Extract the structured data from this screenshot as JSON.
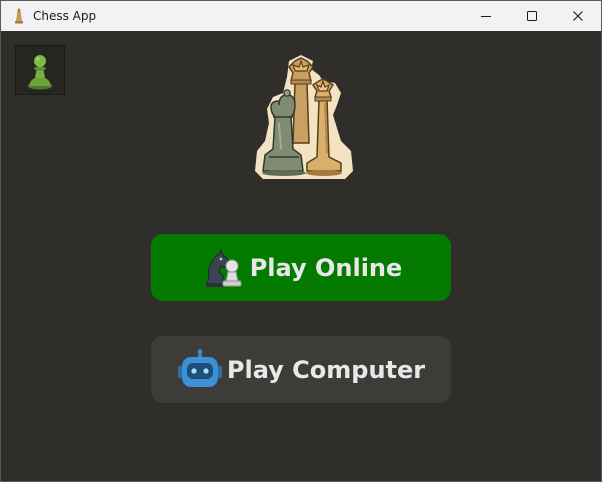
{
  "window": {
    "title": "Chess App",
    "icons": {
      "app": "chess-king-icon",
      "minimize": "minimize-icon",
      "maximize": "maximize-icon",
      "close": "close-icon"
    }
  },
  "main": {
    "thumbnail_icon": "pawn-icon",
    "logo": "chess-pieces-logo",
    "buttons": {
      "play_online": {
        "label": "Play Online",
        "icon": "knight-pawn-icon",
        "color": "#047a00"
      },
      "play_computer": {
        "label": "Play Computer",
        "icon": "robot-icon",
        "color": "#3e3c39"
      }
    }
  },
  "colors": {
    "background": "#2f2e2b",
    "titlebar": "#f3f1f3",
    "text": "#e8e8e8"
  }
}
